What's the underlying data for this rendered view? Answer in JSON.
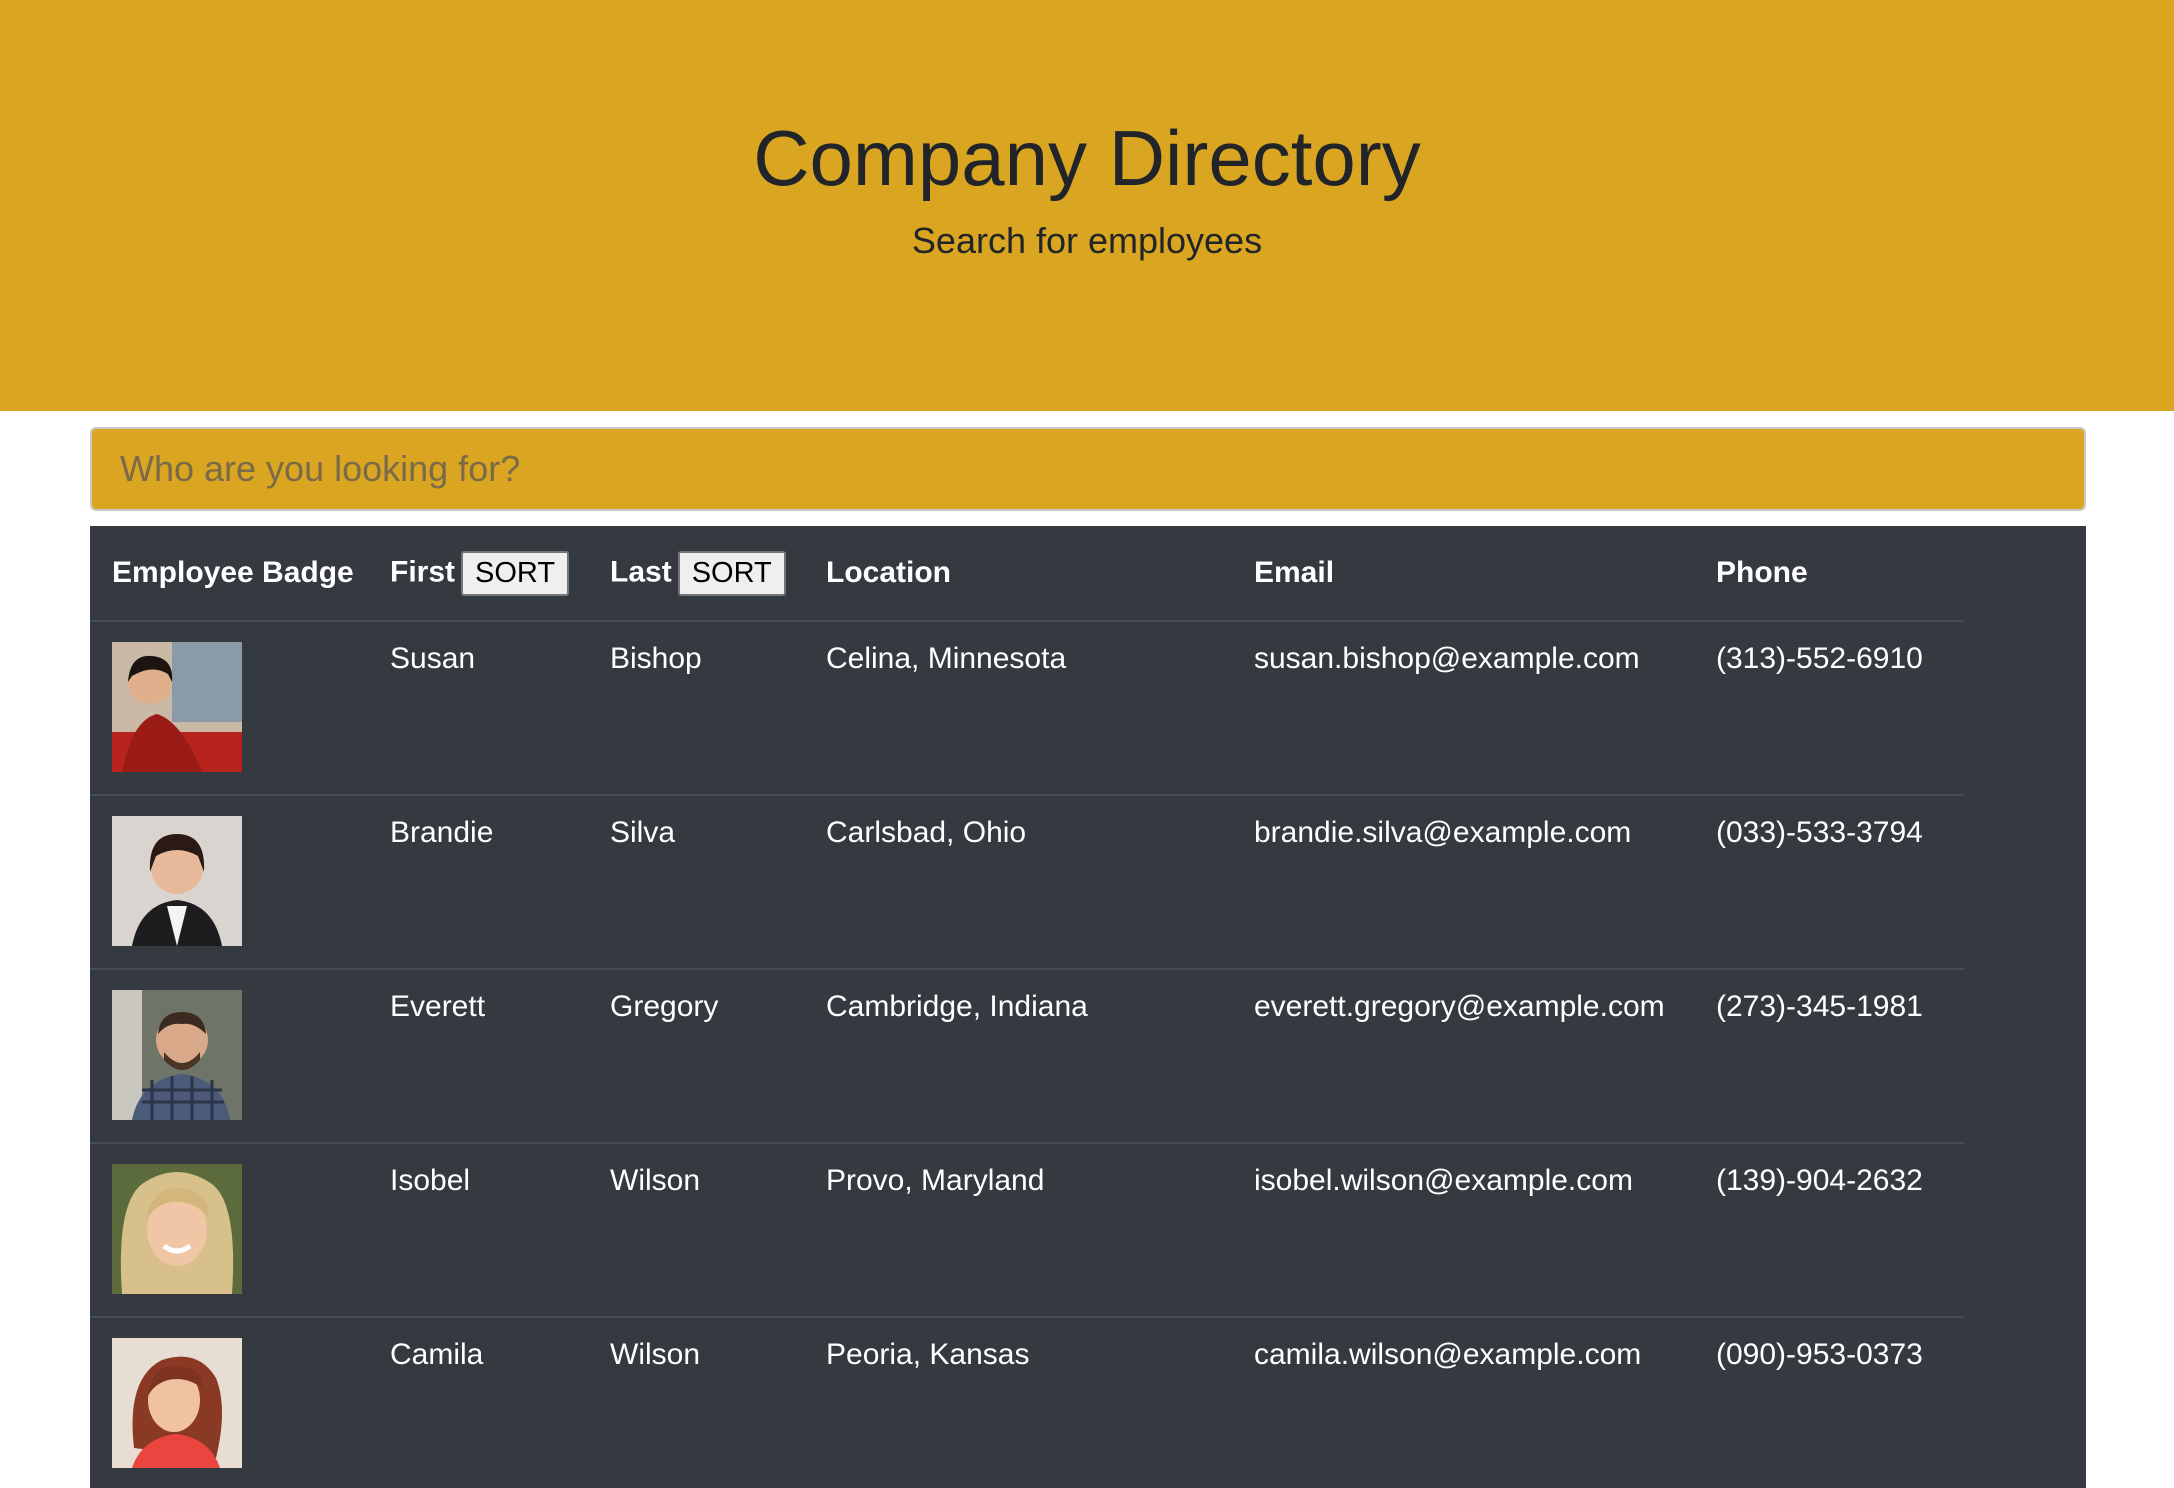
{
  "hero": {
    "title": "Company Directory",
    "subtitle": "Search for employees"
  },
  "search": {
    "placeholder": "Who are you looking for?",
    "value": ""
  },
  "table": {
    "headers": {
      "badge": "Employee Badge",
      "first": "First",
      "last": "Last",
      "location": "Location",
      "email": "Email",
      "phone": "Phone",
      "sort_label": "SORT"
    },
    "rows": [
      {
        "first": "Susan",
        "last": "Bishop",
        "location": "Celina, Minnesota",
        "email": "susan.bishop@example.com",
        "phone": "(313)-552-6910"
      },
      {
        "first": "Brandie",
        "last": "Silva",
        "location": "Carlsbad, Ohio",
        "email": "brandie.silva@example.com",
        "phone": "(033)-533-3794"
      },
      {
        "first": "Everett",
        "last": "Gregory",
        "location": "Cambridge, Indiana",
        "email": "everett.gregory@example.com",
        "phone": "(273)-345-1981"
      },
      {
        "first": "Isobel",
        "last": "Wilson",
        "location": "Provo, Maryland",
        "email": "isobel.wilson@example.com",
        "phone": "(139)-904-2632"
      },
      {
        "first": "Camila",
        "last": "Wilson",
        "location": "Peoria, Kansas",
        "email": "camila.wilson@example.com",
        "phone": "(090)-953-0373"
      }
    ]
  },
  "colors": {
    "hero_bg": "#daa520",
    "table_bg": "#343a40"
  }
}
